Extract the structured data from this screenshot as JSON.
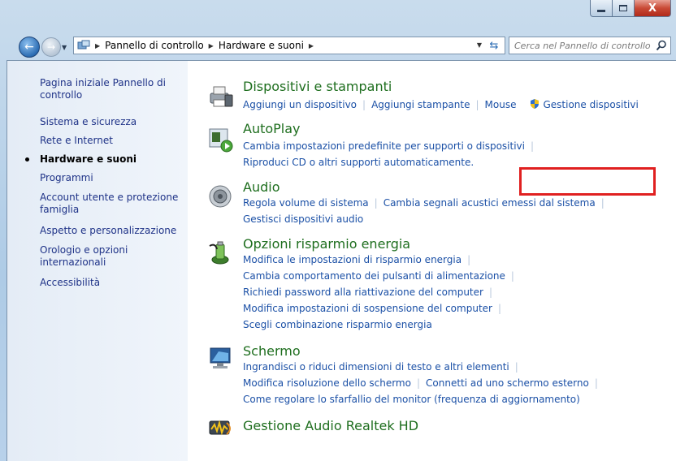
{
  "window": {
    "close_glyph": "X"
  },
  "nav": {
    "breadcrumbs": [
      "Pannello di controllo",
      "Hardware e suoni"
    ],
    "search_placeholder": "Cerca nel Pannello di controllo"
  },
  "sidebar": {
    "items": [
      {
        "label": "Pagina iniziale Pannello di controllo"
      },
      {
        "label": "Sistema e sicurezza"
      },
      {
        "label": "Rete e Internet"
      },
      {
        "label": "Hardware e suoni",
        "active": true
      },
      {
        "label": "Programmi"
      },
      {
        "label": "Account utente e protezione famiglia"
      },
      {
        "label": "Aspetto e personalizzazione"
      },
      {
        "label": "Orologio e opzioni internazionali"
      },
      {
        "label": "Accessibilità"
      }
    ]
  },
  "categories": [
    {
      "title": "Dispositivi e stampanti",
      "icon": "printer-icon",
      "links": [
        "Aggiungi un dispositivo",
        "Aggiungi stampante",
        "Mouse",
        "Gestione dispositivi"
      ]
    },
    {
      "title": "AutoPlay",
      "icon": "autoplay-icon",
      "links": [
        "Cambia impostazioni predefinite per supporti o dispositivi",
        "Riproduci CD o altri supporti automaticamente."
      ]
    },
    {
      "title": "Audio",
      "icon": "speaker-icon",
      "links": [
        "Regola volume di sistema",
        "Cambia segnali acustici emessi dal sistema",
        "Gestisci dispositivi audio"
      ]
    },
    {
      "title": "Opzioni risparmio energia",
      "icon": "power-icon",
      "links": [
        "Modifica le impostazioni di risparmio energia",
        "Cambia comportamento dei pulsanti di alimentazione",
        "Richiedi password alla riattivazione del computer",
        "Modifica impostazioni di sospensione del computer",
        "Scegli combinazione risparmio energia"
      ]
    },
    {
      "title": "Schermo",
      "icon": "display-icon",
      "links": [
        "Ingrandisci o riduci dimensioni di testo e altri elementi",
        "Modifica risoluzione dello schermo",
        "Connetti ad uno schermo esterno",
        "Come regolare lo sfarfallio del monitor (frequenza di aggiornamento)"
      ]
    },
    {
      "title": "Gestione Audio Realtek HD",
      "icon": "realtek-audio-icon",
      "links": []
    }
  ],
  "colors": {
    "highlight_box": "#e02020",
    "category_title": "#1e6e1e",
    "link": "#1b50a6"
  }
}
